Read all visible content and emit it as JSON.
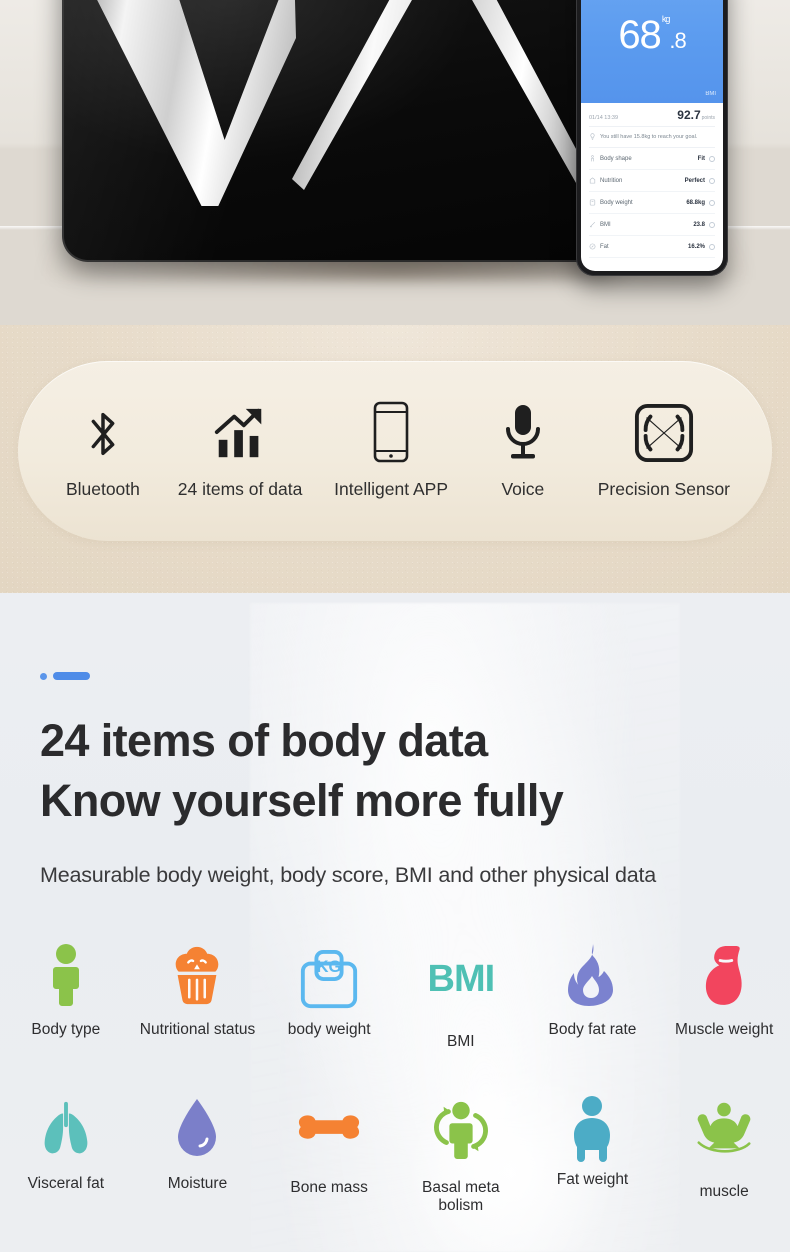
{
  "hero": {
    "alt_scale": "black glass body fat scale on wooden table",
    "phone_app": {
      "weight_int": "68",
      "weight_dec": ".8",
      "weight_unit": "kg",
      "corner_badge": "BMI",
      "date": "01/14 13:39",
      "score": "92.7",
      "score_unit": "points",
      "goal_text": "You still have 15.8kg to reach your goal.",
      "rows": [
        {
          "label": "Body shape",
          "value": "Fit"
        },
        {
          "label": "Nutrition",
          "value": "Perfect"
        },
        {
          "label": "Body weight",
          "value": "68.8kg"
        },
        {
          "label": "BMI",
          "value": "23.8"
        },
        {
          "label": "Fat",
          "value": "16.2%"
        }
      ]
    }
  },
  "features": {
    "items": [
      {
        "label": "Bluetooth",
        "icon": "bluetooth-icon"
      },
      {
        "label": "24 items of data",
        "icon": "bar-chart-growth-icon"
      },
      {
        "label": "Intelligent APP",
        "icon": "smartphone-icon"
      },
      {
        "label": "Voice",
        "icon": "microphone-icon"
      },
      {
        "label": "Precision Sensor",
        "icon": "precision-sensor-icon"
      }
    ]
  },
  "data_section": {
    "headline_line1": "24 items of body data",
    "headline_line2": "Know yourself more fully",
    "subline": "Measurable body weight, body score, BMI and other physical data",
    "accent_color": "#4f8ce8",
    "metrics": [
      {
        "label": "Body type",
        "icon": "person-icon",
        "color": "#8bc34a"
      },
      {
        "label": "Nutritional status",
        "icon": "cupcake-icon",
        "color": "#f58233"
      },
      {
        "label": "body weight",
        "icon": "kg-scale-icon",
        "color": "#5bb8ef"
      },
      {
        "label": "BMI",
        "icon": "bmi-text-icon",
        "color": "#4fc0b4"
      },
      {
        "label": "Body fat rate",
        "icon": "flame-icon",
        "color": "#7b82cf"
      },
      {
        "label": "Muscle weight",
        "icon": "bicep-icon",
        "color": "#f2455e"
      },
      {
        "label": "Visceral fat",
        "icon": "lungs-icon",
        "color": "#5cc0bb"
      },
      {
        "label": "Moisture",
        "icon": "water-drop-icon",
        "color": "#7b7fc9"
      },
      {
        "label": "Bone mass",
        "icon": "bone-icon",
        "color": "#f58233"
      },
      {
        "label": "Basal meta bolism",
        "icon": "metabolism-cycle-icon",
        "color": "#8bc34a"
      },
      {
        "label": "Fat weight",
        "icon": "heavy-person-icon",
        "color": "#4cacc6"
      },
      {
        "label": "muscle",
        "icon": "flexing-muscle-icon",
        "color": "#8bc34a"
      }
    ]
  }
}
